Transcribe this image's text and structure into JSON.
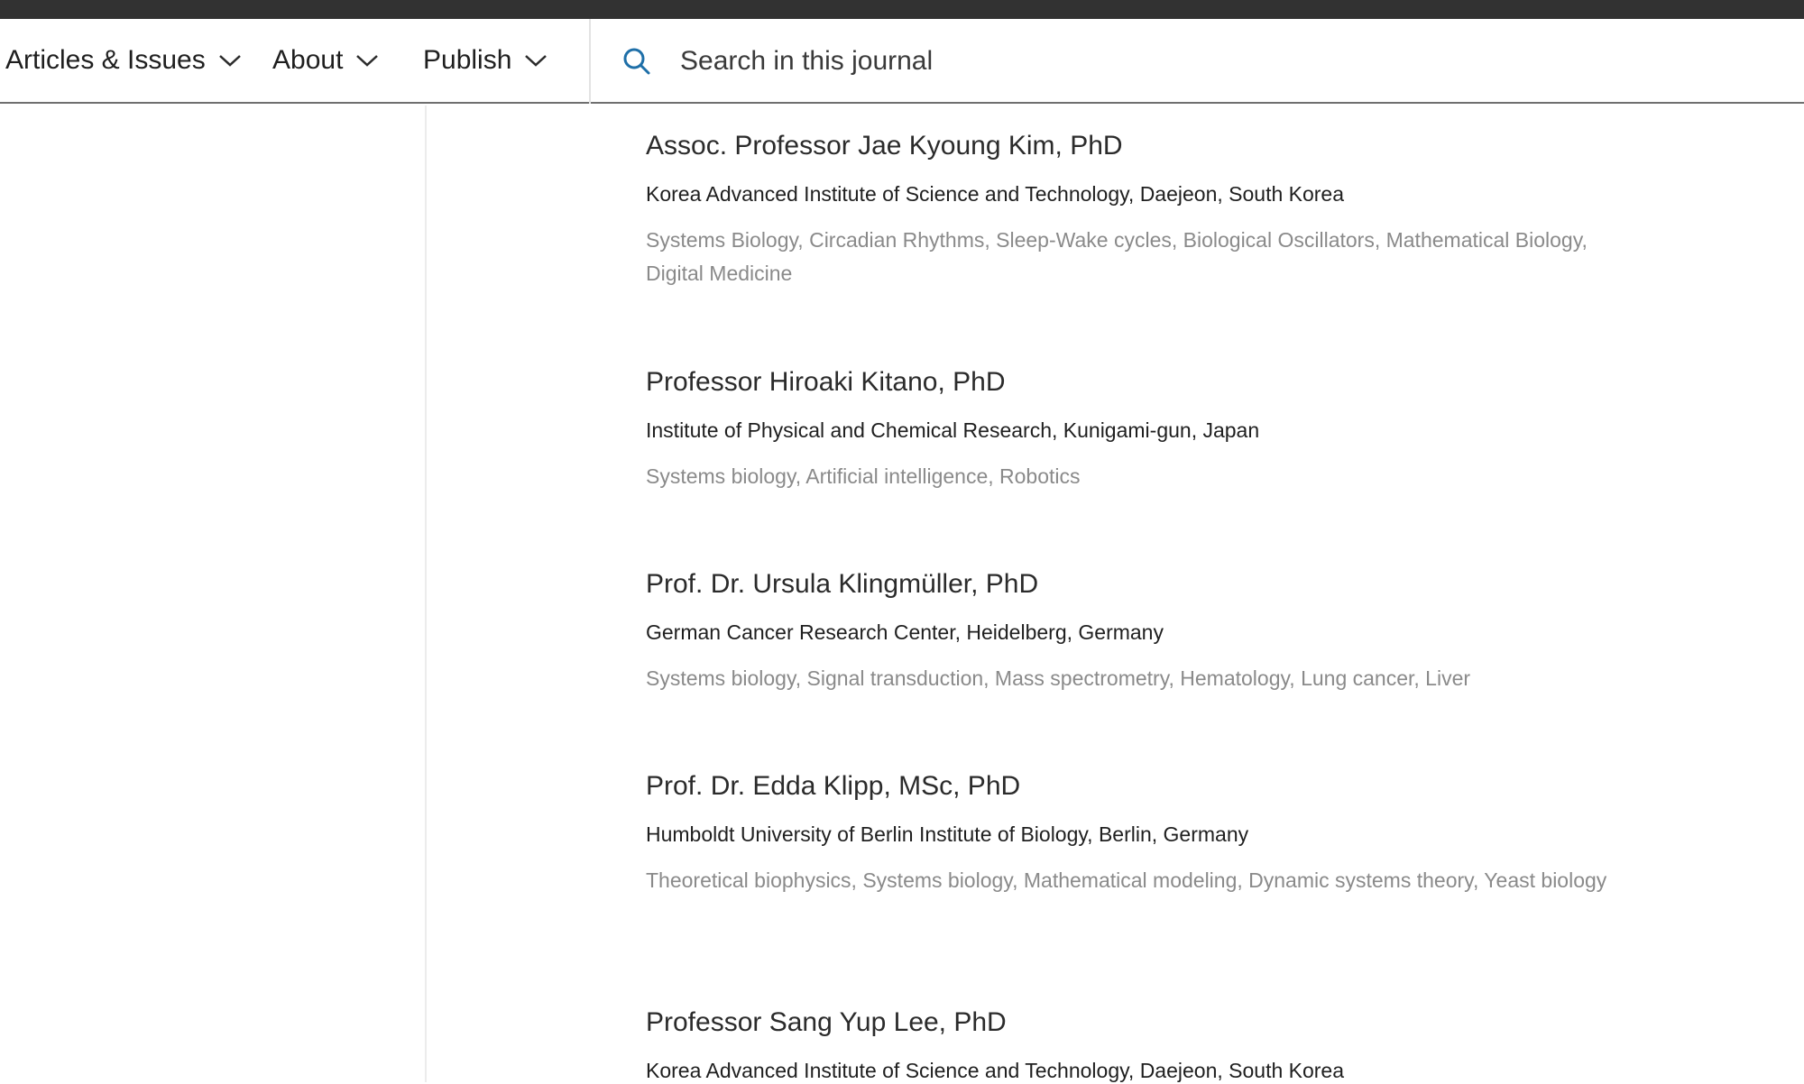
{
  "nav": {
    "items": [
      {
        "label": "Articles & Issues"
      },
      {
        "label": "About"
      },
      {
        "label": "Publish"
      }
    ]
  },
  "search": {
    "placeholder": "Search in this journal",
    "icon": "search-icon",
    "icon_color": "#1e6fa8"
  },
  "members": [
    {
      "name": "Assoc. Professor Jae Kyoung Kim, PhD",
      "affiliation": "Korea Advanced Institute of Science and Technology, Daejeon, South Korea",
      "interests": "Systems Biology, Circadian Rhythms, Sleep-Wake cycles, Biological Oscillators, Mathematical Biology, Digital Medicine"
    },
    {
      "name": "Professor Hiroaki Kitano, PhD",
      "affiliation": "Institute of Physical and Chemical Research, Kunigami-gun, Japan",
      "interests": "Systems biology,  Artificial intelligence,  Robotics"
    },
    {
      "name": "Prof. Dr. Ursula Klingmüller, PhD",
      "affiliation": "German Cancer Research Center, Heidelberg, Germany",
      "interests": "Systems biology,  Signal transduction,  Mass spectrometry,  Hematology,  Lung cancer,  Liver"
    },
    {
      "name": "Prof. Dr. Edda Klipp, MSc, PhD",
      "affiliation": "Humboldt University of Berlin Institute of Biology, Berlin, Germany",
      "interests": "Theoretical biophysics,  Systems biology,  Mathematical modeling,  Dynamic systems theory,  Yeast biology"
    },
    {
      "name": "Professor Sang Yup Lee, PhD",
      "affiliation": "Korea Advanced Institute of Science and Technology, Daejeon, South Korea",
      "interests": ""
    }
  ]
}
